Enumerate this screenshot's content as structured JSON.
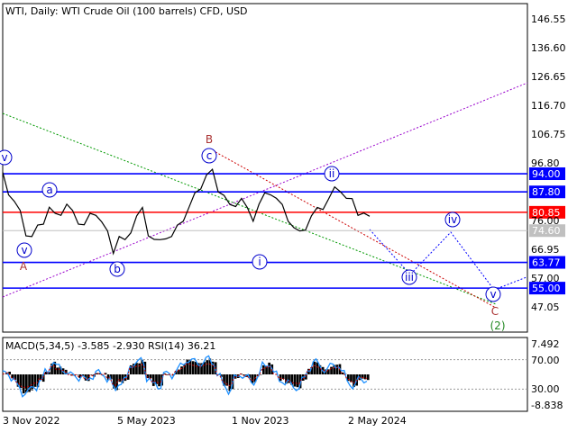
{
  "header": {
    "title": "WTI, Daily:  WTI Crude Oil (100 barrels) CFD, USD"
  },
  "chart_data": [
    {
      "type": "line",
      "title": "WTI, Daily:  WTI Crude Oil (100 barrels) CFD, USD",
      "ylim": [
        40,
        152
      ],
      "y_ticks": [
        "146.55",
        "136.60",
        "126.65",
        "116.70",
        "106.75",
        "96.80",
        "76.00",
        "66.95",
        "57.00",
        "47.05"
      ],
      "x_ticks": [
        "3 Nov 2022",
        "5 May 2023",
        "1 Nov 2023",
        "2 May 2024"
      ],
      "series": [
        {
          "values": [
            93,
            88,
            84,
            80,
            74,
            72,
            75,
            78,
            82,
            79,
            81,
            83,
            80,
            78,
            76,
            79,
            81,
            77,
            73,
            68,
            72,
            70,
            75,
            79,
            81,
            74,
            71,
            70,
            73,
            72,
            75,
            79,
            82,
            86,
            90,
            93,
            94,
            89,
            86,
            82,
            84,
            85,
            81,
            79,
            83,
            86,
            88,
            85,
            82,
            79,
            75,
            73,
            76,
            79,
            81,
            83,
            85,
            88,
            89,
            85,
            84,
            81,
            80,
            78
          ]
        }
      ],
      "levels": [
        {
          "label": "94.00",
          "value": 94.0,
          "color": "#0000ff"
        },
        {
          "label": "87.80",
          "value": 87.8,
          "color": "#0000ff"
        },
        {
          "label": "80.85",
          "value": 80.85,
          "color": "#ff0000"
        },
        {
          "label": "74.60",
          "value": 74.6,
          "color": "#c0c0c0"
        },
        {
          "label": "63.77",
          "value": 63.77,
          "color": "#0000ff"
        },
        {
          "label": "55.00",
          "value": 55.0,
          "color": "#0000ff"
        }
      ],
      "wave_labels": [
        "v",
        "a",
        "A",
        "B",
        "c",
        "b",
        "ii",
        "i",
        "iv",
        "iii",
        "v",
        "C",
        "(2)"
      ],
      "grid": false
    },
    {
      "type": "line",
      "title": "MACD(5,34,5) -3.585 -2.930 RSI(14) 36.21",
      "ylim": [
        -8.838,
        7.492
      ],
      "y_ticks": [
        "7.492",
        "70.00",
        "30.00",
        "-8.838"
      ],
      "indicator": {
        "name": "MACD(5,34,5)",
        "main": -3.585,
        "signal": -2.93
      },
      "rsi": {
        "name": "RSI(14)",
        "value": 36.21,
        "levels": [
          70,
          30
        ]
      },
      "grid": false
    }
  ]
}
